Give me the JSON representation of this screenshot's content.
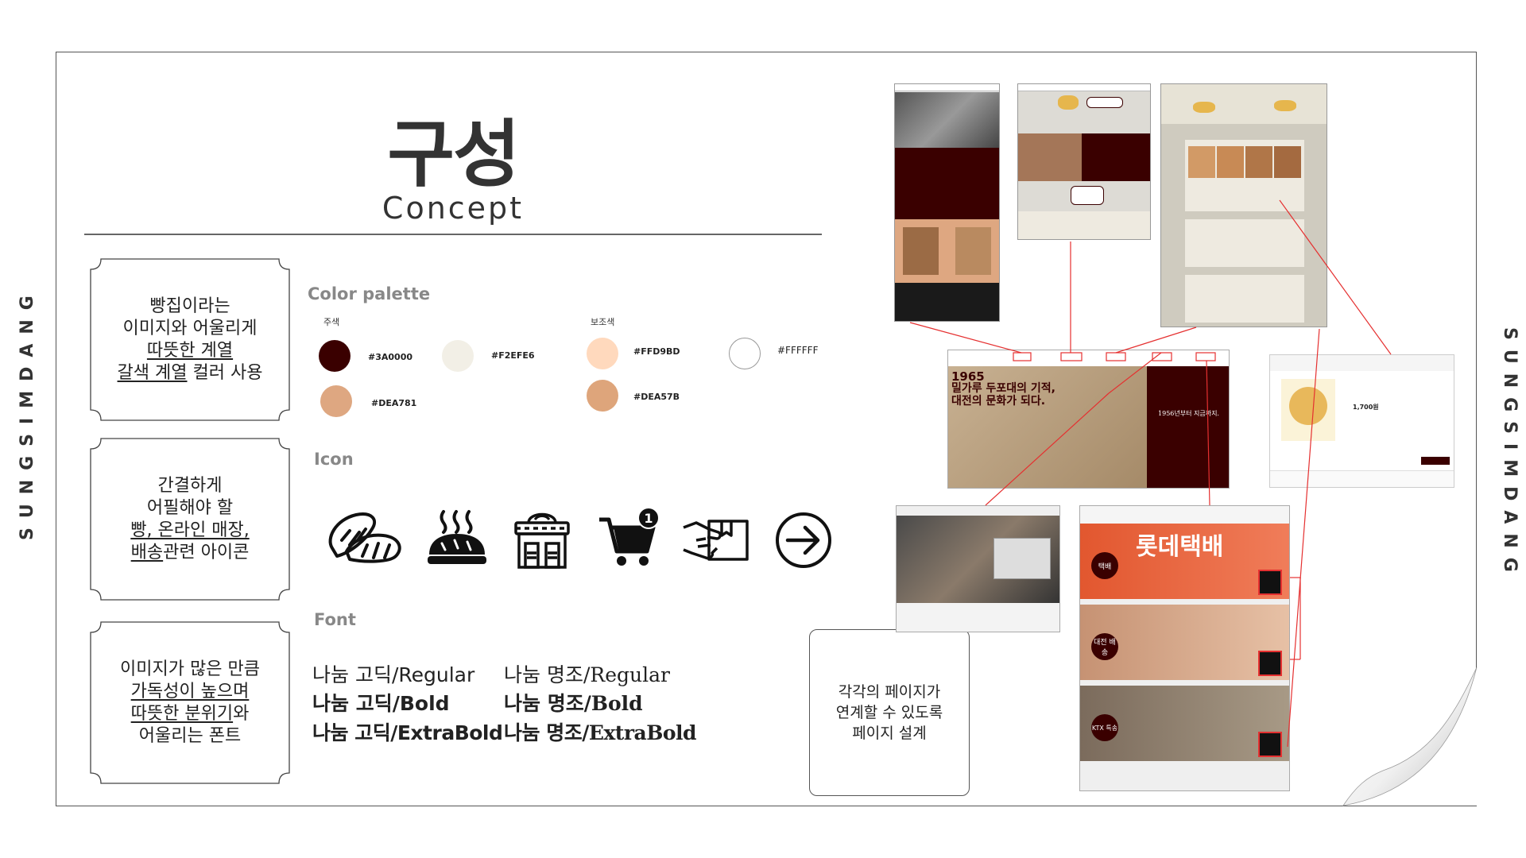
{
  "side_text_left": "SUNGSIMDANG",
  "side_text_right": "SUNGSIMDANG",
  "title": "구성",
  "subtitle": "Concept",
  "cards": [
    {
      "lines": [
        "빵집이라는",
        "이미지와 어울리게",
        "따뜻한 계열",
        "갈색 계열",
        " 컬러 사용"
      ]
    },
    {
      "lines": [
        "간결하게",
        "어필해야 할",
        "빵, 온라인 매장,",
        "배송",
        "관련 아이콘"
      ]
    },
    {
      "lines": [
        "이미지가 많은 만큼",
        "가독성이 높으며",
        "따뜻한 분위기",
        "와",
        "어울리는 폰트"
      ]
    }
  ],
  "color_palette": {
    "label": "Color palette",
    "main_label": "주색",
    "sub_label": "보조색",
    "main": [
      {
        "hex_label": "#3A0000",
        "color": "#3A0000"
      },
      {
        "hex_label": "#F2EFE6",
        "color": "#F2EFE6"
      },
      {
        "hex_label": "#DEA781",
        "color": "#DEA781"
      }
    ],
    "sub": [
      {
        "hex_label": "#FFD9BD",
        "color": "#FFD9BD"
      },
      {
        "hex_label": "#FFFFFF",
        "color": "#FFFFFF"
      },
      {
        "hex_label": "#DEA57B",
        "color": "#DEA57B"
      }
    ]
  },
  "icon_section": {
    "label": "Icon",
    "icons": [
      "bread-icon",
      "bread-loaf-icon",
      "bakery-store-icon",
      "cart-icon",
      "delivery-box-icon",
      "arrow-right-icon"
    ],
    "cart_badge": "1"
  },
  "font_section": {
    "label": "Font",
    "gothic": [
      "나눔 고딕/Regular",
      "나눔 고딕/Bold",
      "나눔 고딕/ExtraBold"
    ],
    "myeongjo": [
      "나눔 명조/Regular",
      "나눔 명조/Bold",
      "나눔 명조/ExtraBold"
    ]
  },
  "note": {
    "lines": [
      "각각의 페이지가",
      "연계할 수 있도록",
      "페이지 설계"
    ]
  },
  "mockups": {
    "hero_year": "1965",
    "hero_headline_1": "밀가루 두포대의 기적,",
    "hero_headline_2": "대전의 문화가 되다.",
    "hero_side": "1956년부터 지금까지.",
    "delivery_labels": [
      "택배",
      "대전 배송",
      "KTX 특송"
    ],
    "delivery_banner": "롯데택배",
    "product_price": "1,700원",
    "colors": {
      "accent": "#3A0000",
      "red": "#E53030",
      "beige": "#F2EFE6",
      "tan": "#DEA781"
    }
  }
}
